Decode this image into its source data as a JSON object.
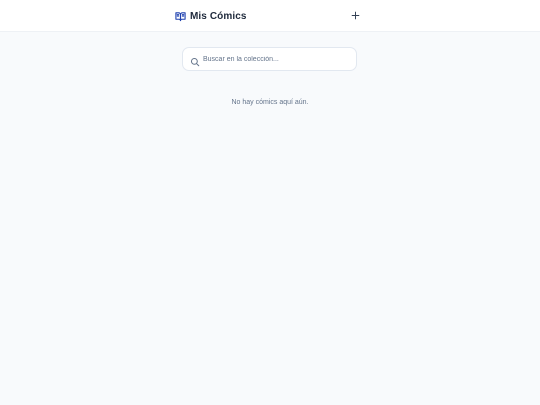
{
  "header": {
    "title": "Mis Cómics",
    "logo_icon": "book-open-icon",
    "add_icon": "plus-icon"
  },
  "search": {
    "placeholder": "Buscar en la colección...",
    "value": "",
    "icon": "search-icon"
  },
  "main": {
    "empty_message": "No hay cómics aquí aún."
  },
  "colors": {
    "accent": "#1e40af",
    "background": "#f8fafc",
    "text": "#1e293b",
    "muted": "#64748b"
  }
}
